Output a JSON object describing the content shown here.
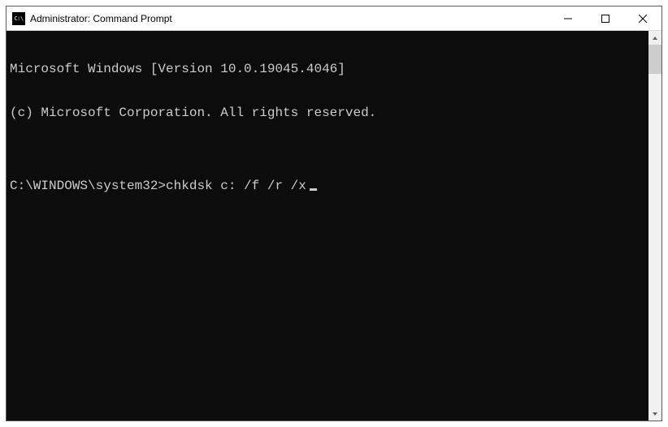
{
  "titlebar": {
    "icon_text": "C:\\",
    "title": "Administrator: Command Prompt"
  },
  "terminal": {
    "line1": "Microsoft Windows [Version 10.0.19045.4046]",
    "line2": "(c) Microsoft Corporation. All rights reserved.",
    "blank": "",
    "prompt": "C:\\WINDOWS\\system32>",
    "command": "chkdsk c: /f /r /x"
  }
}
